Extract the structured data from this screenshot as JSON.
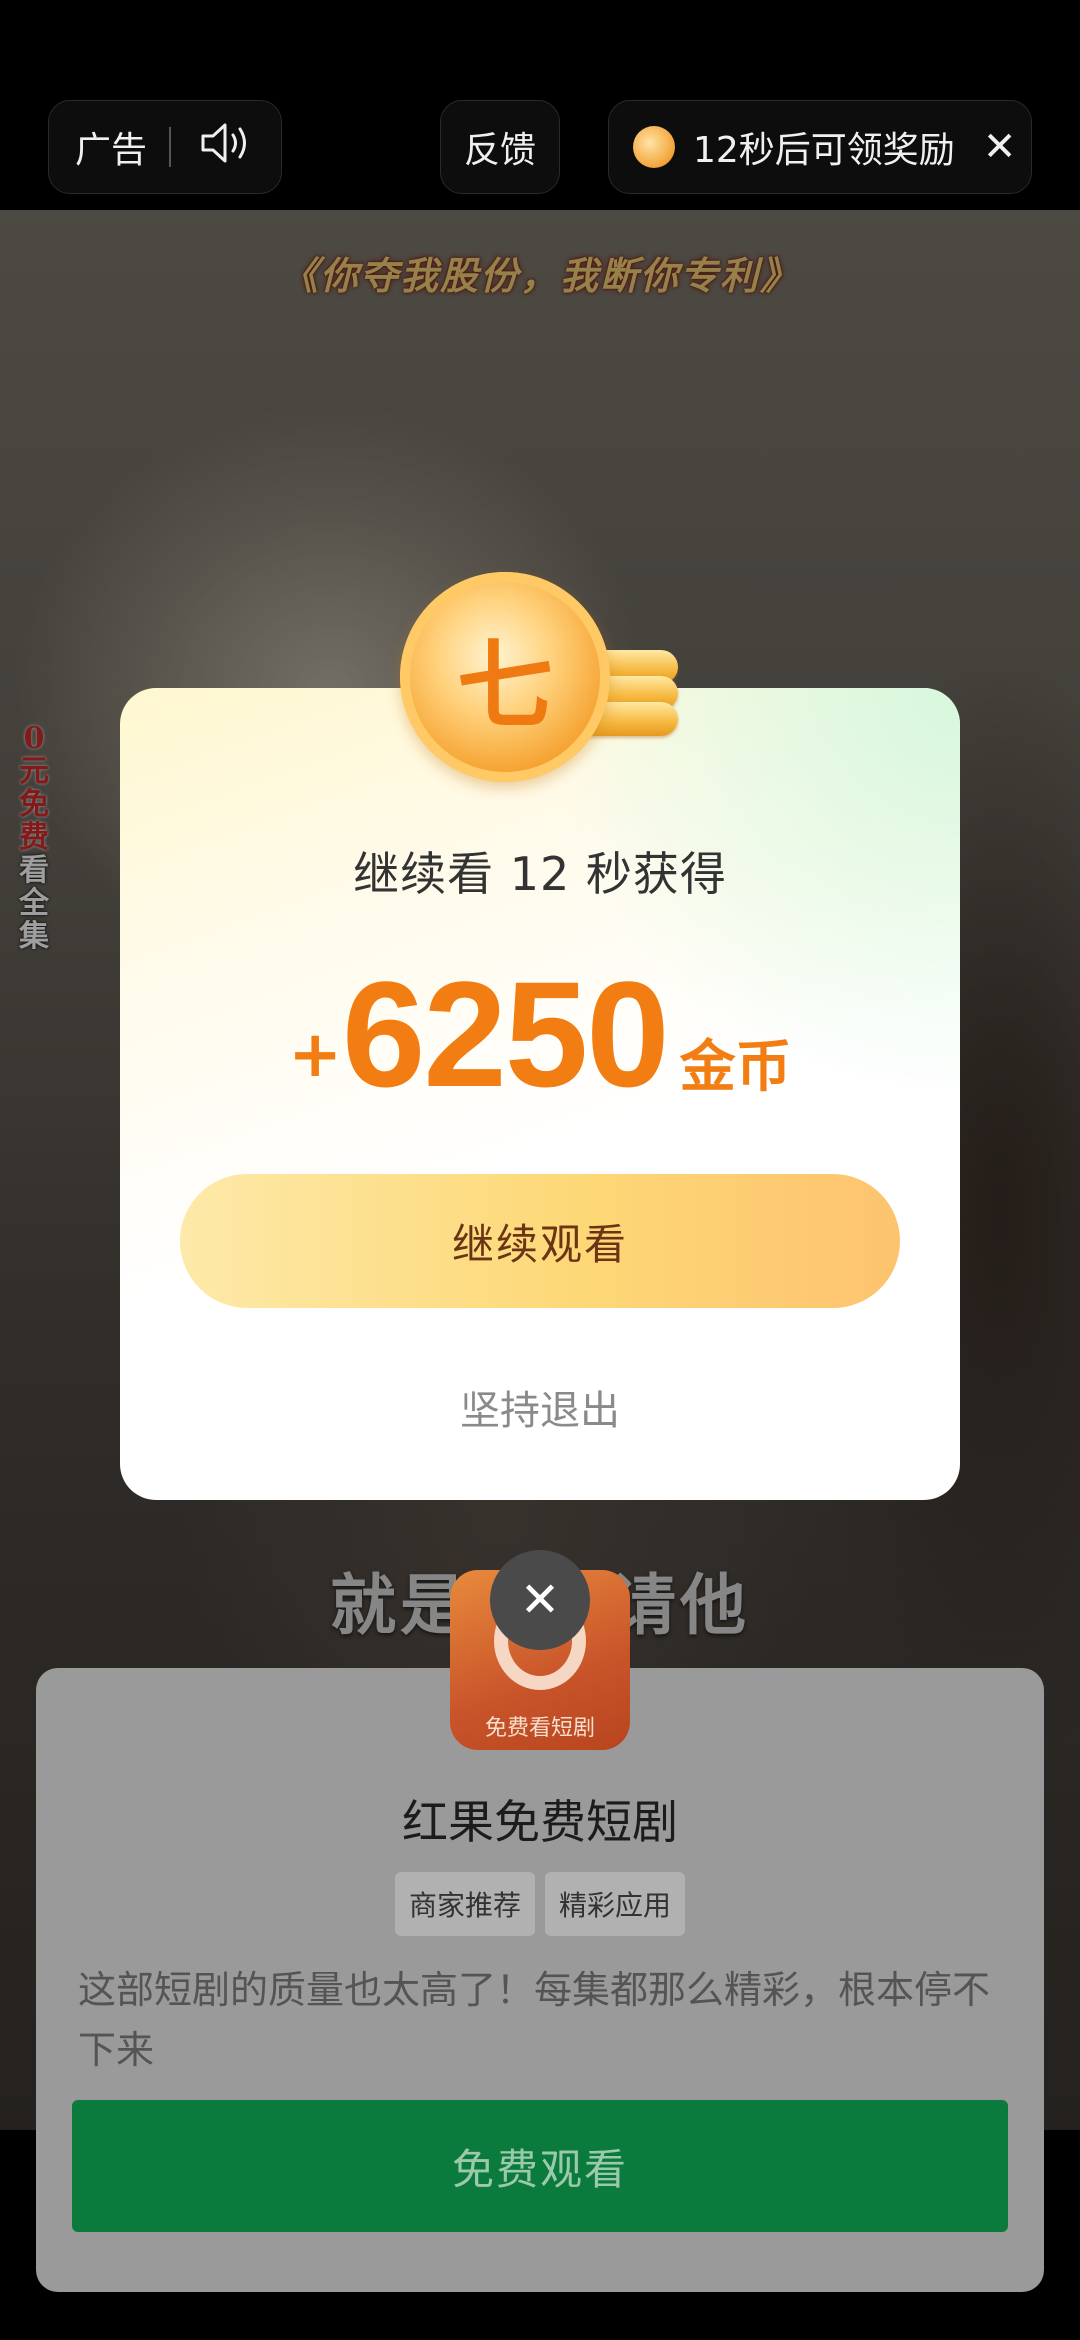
{
  "topbar": {
    "ad_label": "广告",
    "feedback_label": "反馈",
    "reward_countdown": "12秒后可领奖励",
    "close_glyph": "✕"
  },
  "video": {
    "title_overlay": "《你夺我股份，我断你专利》",
    "side_text_red": [
      "0",
      "元",
      "免",
      "费"
    ],
    "side_text_white": [
      "看",
      "全",
      "集"
    ],
    "subtitle": "就是这宴请他"
  },
  "dialog": {
    "title": "继续看 12 秒获得",
    "plus": "+",
    "amount": "6250",
    "unit": "金币",
    "continue_label": "继续观看",
    "quit_label": "坚持退出",
    "coin_glyph": "七"
  },
  "ad_card": {
    "close_glyph": "✕",
    "icon_label": "免费看短剧",
    "app_name": "红果免费短剧",
    "tags": [
      "商家推荐",
      "精彩应用"
    ],
    "description": "这部短剧的质量也太高了！每集都那么精彩，根本停不下来",
    "cta_label": "免费观看"
  },
  "colors": {
    "reward_orange": "#f27d12",
    "cta_green": "#0a7a3d",
    "button_gold": "#fdd877"
  }
}
